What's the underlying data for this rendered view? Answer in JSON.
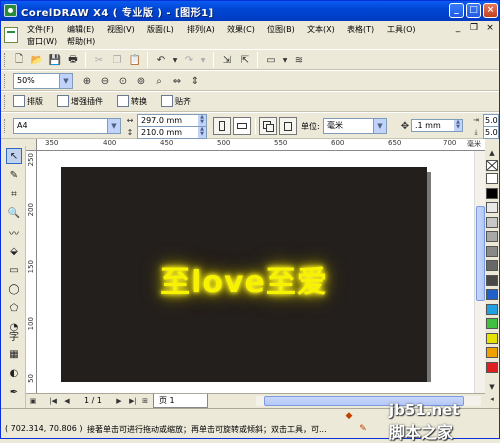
{
  "window": {
    "title": "CorelDRAW X4 ( 专业版 ) - [图形1]"
  },
  "title_buttons": {
    "minimize": "_",
    "maximize": "□",
    "close": "×"
  },
  "menu": {
    "row1": [
      "文件(F)",
      "编辑(E)",
      "视图(V)",
      "版面(L)",
      "排列(A)",
      "效果(C)",
      "位图(B)",
      "文本(X)",
      "表格(T)",
      "工具(O)"
    ],
    "row2": [
      "窗口(W)",
      "帮助(H)"
    ]
  },
  "zoom_combo": {
    "value": "50%"
  },
  "plugin_bar": {
    "items": [
      "排版",
      "增强插件",
      "转换",
      "贴齐"
    ]
  },
  "property_bar": {
    "paper_size": "A4",
    "width": "297.0 mm",
    "height": "210.0 mm",
    "unit_label": "单位:",
    "unit_value": "毫米",
    "nudge": ".1 mm",
    "dup_x": "5.0",
    "dup_y": "5.0"
  },
  "ruler": {
    "top_ticks": [
      "350",
      "400",
      "450",
      "500",
      "550",
      "600",
      "650",
      "700"
    ],
    "top_unit": "毫米",
    "left_ticks": [
      "250",
      "200",
      "150",
      "100",
      "50"
    ]
  },
  "canvas": {
    "text": "至love至爱",
    "text_color": "#f7f300",
    "page_color": "#231f1c"
  },
  "navigator": {
    "page_count": "1 / 1",
    "page_tab": "页 1"
  },
  "status": {
    "coords": "( 702.314, 70.806 )",
    "hint": "接著单击可进行拖动或缩放；再单击可旋转或倾斜；双击工具，可..."
  },
  "palette": {
    "colors": [
      "#ffffff",
      "#000000",
      "#e8e8e8",
      "#c8c8c8",
      "#a8a8a8",
      "#888888",
      "#686868",
      "#484848",
      "#2060c8",
      "#20a0e0",
      "#40c040",
      "#e8e000",
      "#f0a000",
      "#e02020"
    ]
  },
  "watermark": {
    "line1": "jb51.net",
    "line2": "脚本之家"
  }
}
